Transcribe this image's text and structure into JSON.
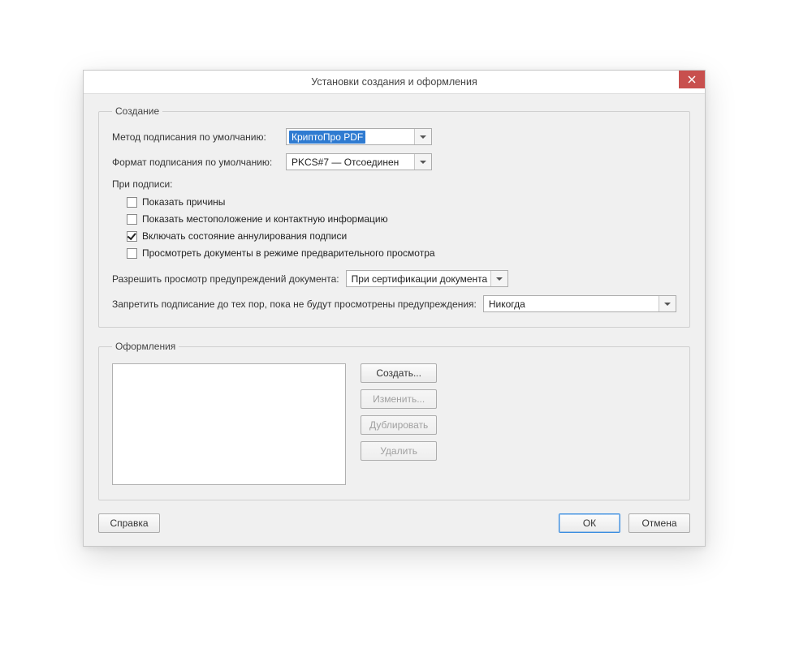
{
  "window": {
    "title": "Установки создания и оформления"
  },
  "creation": {
    "legend": "Создание",
    "method_label": "Метод подписания по умолчанию:",
    "method_value": "КриптоПро PDF",
    "format_label": "Формат подписания по умолчанию:",
    "format_value": "PKCS#7 — Отсоединен",
    "when_signing_label": "При подписи:",
    "checkboxes": {
      "show_reasons": {
        "label": "Показать причины",
        "checked": false
      },
      "show_location": {
        "label": "Показать местоположение и контактную информацию",
        "checked": false
      },
      "include_revoc": {
        "label": "Включать состояние аннулирования подписи",
        "checked": true
      },
      "preview_docs": {
        "label": "Просмотреть документы в режиме предварительного просмотра",
        "checked": false
      }
    },
    "allow_warn_label": "Разрешить просмотр предупреждений документа:",
    "allow_warn_value": "При сертификации документа",
    "prevent_sign_label": "Запретить подписание до тех пор, пока не будут просмотрены предупреждения:",
    "prevent_sign_value": "Никогда"
  },
  "appearance": {
    "legend": "Оформления",
    "buttons": {
      "create": "Создать...",
      "edit": "Изменить...",
      "duplicate": "Дублировать",
      "delete": "Удалить"
    }
  },
  "footer": {
    "help": "Справка",
    "ok": "ОК",
    "cancel": "Отмена"
  }
}
